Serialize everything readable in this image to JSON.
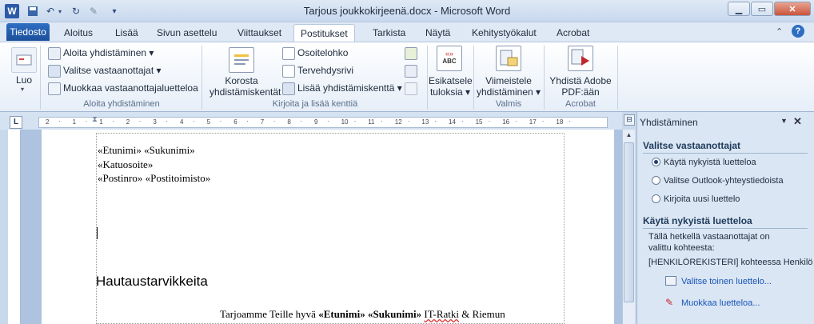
{
  "window": {
    "title": "Tarjous joukkokirjeenä.docx - Microsoft Word"
  },
  "tabs": {
    "file": "Tiedosto",
    "items": [
      "Aloitus",
      "Lisää",
      "Sivun asettelu",
      "Viittaukset",
      "Postitukset",
      "Tarkista",
      "Näytä",
      "Kehitystyökalut",
      "Acrobat"
    ],
    "active": "Postitukset"
  },
  "ribbon": {
    "create": {
      "label": "Luo"
    },
    "start": {
      "aloita": "Aloita yhdistäminen",
      "valitse": "Valitse vastaanottajat",
      "muokkaa": "Muokkaa vastaanottajaluetteloa",
      "group": "Aloita yhdistäminen"
    },
    "fields": {
      "korosta_line1": "Korosta",
      "korosta_line2": "yhdistämiskentät",
      "osoitelohko": "Osoitelohko",
      "tervehdysrivi": "Tervehdysrivi",
      "lisaa": "Lisää yhdistämiskenttä",
      "group": "Kirjoita ja lisää kenttiä"
    },
    "preview": {
      "line1": "Esikatsele",
      "line2": "tuloksia",
      "icon_text": "ABC",
      "icon_top": "«»"
    },
    "finish": {
      "line1": "Viimeistele",
      "line2": "yhdistäminen",
      "group": "Valmis"
    },
    "acrobat": {
      "line1": "Yhdistä Adobe",
      "line2": "PDF:ään",
      "group": "Acrobat"
    }
  },
  "document": {
    "line1_a": "«Etunimi»",
    "line1_b": "«Sukunimi»",
    "line2": "«Katuosoite»",
    "line3_a": "«Postinro»",
    "line3_b": "«Postitoimisto»",
    "heading": "Hautaustarvikkeita",
    "body_a": "Tarjoamme Teille hyvä",
    "body_b": "«Etunimi» «Sukunimi»",
    "body_c": "IT-Ratki",
    "body_d": "& Riemun"
  },
  "ruler": {
    "numbers": [
      "2",
      "1",
      "1",
      "2",
      "3",
      "4",
      "5",
      "6",
      "7",
      "8",
      "9",
      "10",
      "11",
      "12",
      "13",
      "14",
      "15",
      "16",
      "17",
      "18"
    ],
    "l_marker": "L"
  },
  "taskpane": {
    "title": "Yhdistäminen",
    "section1": "Valitse vastaanottajat",
    "options": [
      "Käytä nykyistä luetteloa",
      "Valitse Outlook-yhteystiedoista",
      "Kirjoita uusi luettelo"
    ],
    "section2": "Käytä nykyistä luetteloa",
    "desc_line1": "Tällä hetkellä vastaanottajat on",
    "desc_line2": "valittu kohteesta:",
    "source": "[HENKILÖREKISTERI] kohteessa Henkilör",
    "link1": "Valitse toinen luettelo...",
    "link2": "Muokkaa luetteloa..."
  },
  "colors": {
    "accent": "#2e6ec2",
    "link": "#1a55b8"
  }
}
